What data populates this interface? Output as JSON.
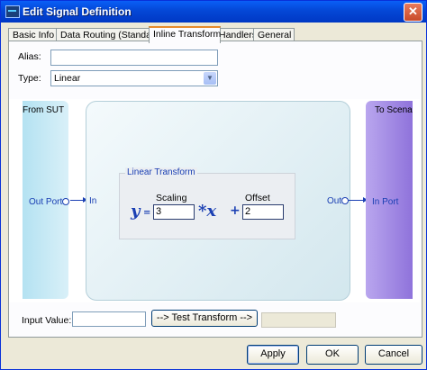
{
  "window": {
    "title": "Edit Signal Definition",
    "close_symbol": "✕"
  },
  "tabs": [
    {
      "label": "Basic Info",
      "active": false
    },
    {
      "label": "Data Routing (Standard)",
      "active": false
    },
    {
      "label": "Inline Transform",
      "active": true
    },
    {
      "label": "Handlers",
      "active": false
    },
    {
      "label": "General",
      "active": false
    }
  ],
  "form": {
    "alias_label": "Alias:",
    "alias_value": "",
    "type_label": "Type:",
    "type_value": "Linear"
  },
  "diagram": {
    "from_block": "From SUT",
    "from_port": "Out Port",
    "transform_in": "In",
    "transform_out": "Out",
    "to_block": "To Scenario",
    "to_port": "In Port",
    "group_title": "Linear Transform",
    "y_symbol": "y",
    "equals_symbol": "=",
    "times_x_symbol": "*x",
    "plus_symbol": "+",
    "scaling_label": "Scaling",
    "scaling_value": "3",
    "offset_label": "Offset",
    "offset_value": "2"
  },
  "test": {
    "input_label": "Input Value:",
    "input_value": "",
    "button_label": "--> Test Transform -->",
    "output_value": ""
  },
  "buttons": {
    "apply": "Apply",
    "ok": "OK",
    "cancel": "Cancel"
  }
}
